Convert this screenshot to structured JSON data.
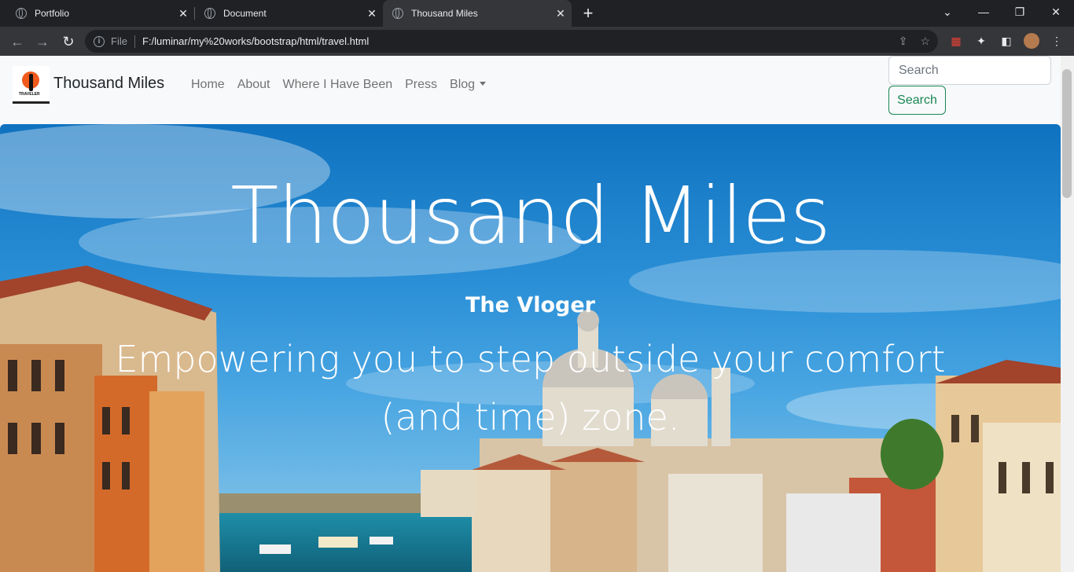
{
  "browser": {
    "tabs": [
      {
        "title": "Portfolio",
        "close": "✕"
      },
      {
        "title": "Document",
        "close": "✕"
      },
      {
        "title": "Thousand Miles",
        "close": "✕",
        "active": true
      }
    ],
    "new_tab": "+",
    "url_scheme_label": "File",
    "url": "F:/luminar/my%20works/bootstrap/html/travel.html"
  },
  "navbar": {
    "brand": "Thousand Miles",
    "logo_text": "TRAVELER",
    "links": [
      "Home",
      "About",
      "Where I Have Been",
      "Press"
    ],
    "dropdown": "Blog",
    "search_placeholder": "Search",
    "search_button": "Search"
  },
  "hero": {
    "title": "Thousand Miles",
    "subtitle": "The Vloger",
    "tagline": "Empowering you to step outside your comfort (and time) zone."
  },
  "colors": {
    "chrome_dark": "#202124",
    "chrome_toolbar": "#35363a",
    "navbar_bg": "#f8f9fa",
    "search_green": "#198754",
    "sky_blue": "#2a8fd6"
  }
}
